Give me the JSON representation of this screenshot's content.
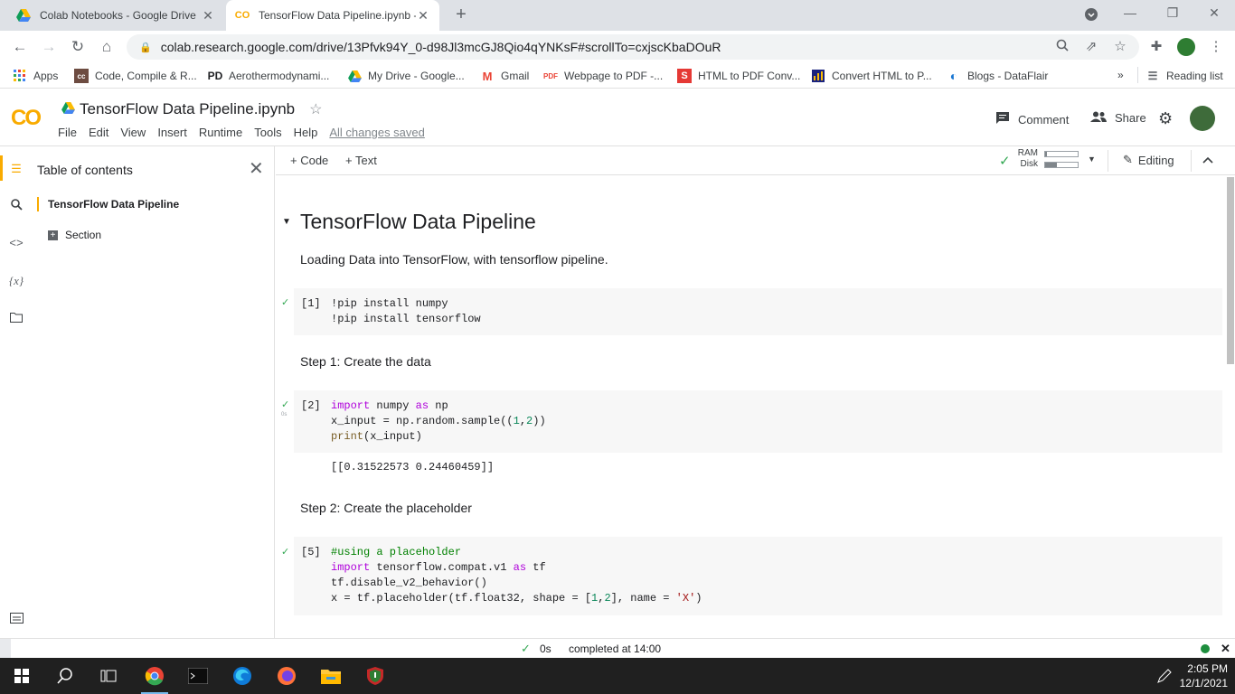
{
  "browser": {
    "tabs": [
      {
        "title": "Colab Notebooks - Google Drive"
      },
      {
        "title": "TensorFlow Data Pipeline.ipynb -"
      }
    ],
    "url": "colab.research.google.com/drive/13Pfvk94Y_0-d98Jl3mcGJ8Qio4qYNKsF#scrollTo=cxjscKbaDOuR",
    "bookmarks": [
      {
        "label": "Apps",
        "icon": "apps-grid-icon"
      },
      {
        "label": "Code, Compile & R...",
        "icon": "cc-icon"
      },
      {
        "label": "Aerothermodynami...",
        "icon": "pd-icon"
      },
      {
        "label": "My Drive - Google...",
        "icon": "drive-icon"
      },
      {
        "label": "Gmail",
        "icon": "gmail-icon"
      },
      {
        "label": "Webpage to PDF -...",
        "icon": "pdf-icon"
      },
      {
        "label": "HTML to PDF Conv...",
        "icon": "s-icon"
      },
      {
        "label": "Convert HTML to P...",
        "icon": "chart-icon"
      },
      {
        "label": "Blogs - DataFlair",
        "icon": "dataflair-icon"
      }
    ],
    "more_bookmarks": "»",
    "reading_list": "Reading list"
  },
  "colab": {
    "logo": "CO",
    "notebook_title": "TensorFlow Data Pipeline.ipynb",
    "menus": [
      "File",
      "Edit",
      "View",
      "Insert",
      "Runtime",
      "Tools",
      "Help"
    ],
    "saved_status": "All changes saved",
    "comment_label": "Comment",
    "share_label": "Share",
    "add_code": "+ Code",
    "add_text": "+ Text",
    "ram_label": "RAM",
    "disk_label": "Disk",
    "ram_fraction": 0.05,
    "disk_fraction": 0.35,
    "editing_label": "Editing"
  },
  "toc": {
    "title": "Table of contents",
    "items": [
      {
        "label": "TensorFlow Data Pipeline",
        "level": 1
      },
      {
        "label": "Section",
        "level": 2
      }
    ]
  },
  "notebook": {
    "heading": "TensorFlow Data Pipeline",
    "intro": "Loading Data into TensorFlow, with tensorflow pipeline.",
    "cells": [
      {
        "run": "[1]",
        "lines": [
          "!pip install numpy",
          "!pip install tensorflow"
        ]
      },
      {
        "md": "Step 1: Create the data"
      },
      {
        "run": "[2]",
        "exec_time": "0s",
        "lines": [
          "import numpy as np",
          "x_input = np.random.sample((1,2))",
          "print(x_input)"
        ],
        "output": "[[0.31522573 0.24460459]]"
      },
      {
        "md": "Step 2: Create the placeholder"
      },
      {
        "run": "[5]",
        "lines": [
          "#using a placeholder",
          "import tensorflow.compat.v1 as tf",
          "tf.disable_v2_behavior()",
          "x = tf.placeholder(tf.float32, shape = [1,2], name = 'X')"
        ]
      }
    ]
  },
  "status": {
    "time": "0s",
    "message": "completed at 14:00"
  },
  "taskbar": {
    "time": "2:05 PM",
    "date": "12/1/2021"
  }
}
